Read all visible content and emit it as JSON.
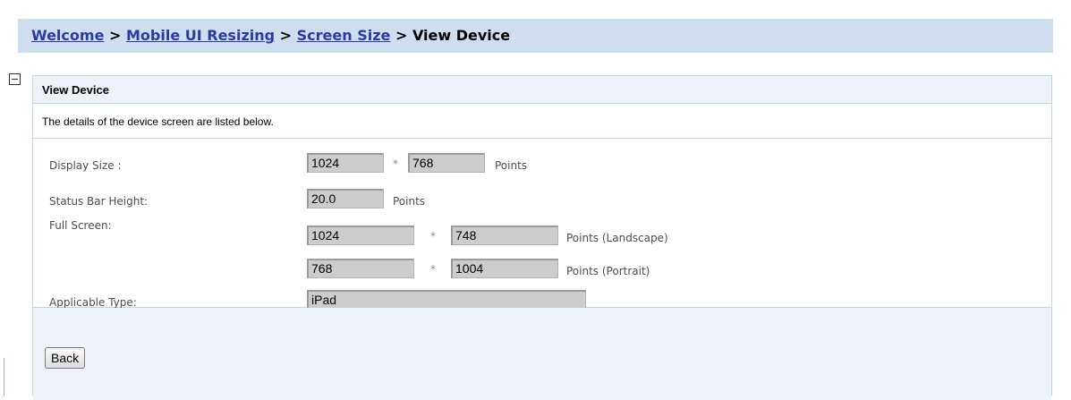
{
  "breadcrumb": {
    "items": [
      "Welcome",
      "Mobile UI Resizing",
      "Screen Size"
    ],
    "separator": ">",
    "current": "View Device"
  },
  "panel": {
    "title": "View Device",
    "description": "The details of the device screen are listed below."
  },
  "form": {
    "display_size": {
      "label": "Display Size :",
      "width": "1024",
      "height": "768",
      "unit": "Points"
    },
    "status_bar": {
      "label": "Status Bar Height:",
      "value": "20.0",
      "unit": "Points"
    },
    "full_screen": {
      "label": "Full Screen:",
      "landscape": {
        "width": "1024",
        "height": "748",
        "unit": "Points (Landscape)"
      },
      "portrait": {
        "width": "768",
        "height": "1004",
        "unit": "Points (Portrait)"
      }
    },
    "applicable_type": {
      "label": "Applicable Type:",
      "value": "iPad"
    },
    "times": "*"
  },
  "footer": {
    "back_label": "Back"
  },
  "colors": {
    "breadcrumb_bg": "#cfdeee",
    "link": "#2a3ba6",
    "panel_bg": "#edf2f8",
    "field_bg": "#cccccc"
  },
  "icons": {
    "collapse": "minus-box-icon"
  }
}
